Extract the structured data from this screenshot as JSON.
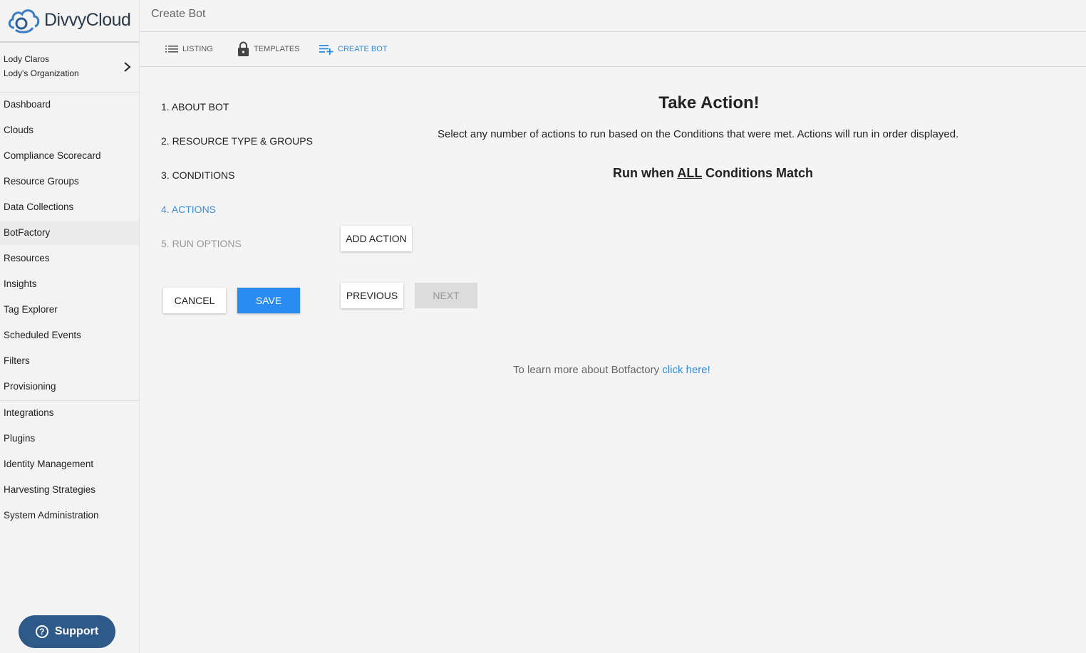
{
  "brand": {
    "name": "DivvyCloud"
  },
  "user": {
    "name": "Lody Claros",
    "organization": "Lody's Organization"
  },
  "sidebar": {
    "items": [
      {
        "label": "Dashboard"
      },
      {
        "label": "Clouds"
      },
      {
        "label": "Compliance Scorecard"
      },
      {
        "label": "Resource Groups"
      },
      {
        "label": "Data Collections"
      },
      {
        "label": "BotFactory"
      },
      {
        "label": "Resources"
      },
      {
        "label": "Insights"
      },
      {
        "label": "Tag Explorer"
      },
      {
        "label": "Scheduled Events"
      },
      {
        "label": "Filters"
      },
      {
        "label": "Provisioning"
      },
      {
        "label": "Integrations"
      },
      {
        "label": "Plugins"
      },
      {
        "label": "Identity Management"
      },
      {
        "label": "Harvesting Strategies"
      },
      {
        "label": "System Administration"
      }
    ],
    "active": "BotFactory",
    "support_label": "Support"
  },
  "header": {
    "title": "Create Bot"
  },
  "tabs": [
    {
      "label": "LISTING",
      "icon": "list-icon"
    },
    {
      "label": "TEMPLATES",
      "icon": "lock-icon"
    },
    {
      "label": "CREATE BOT",
      "icon": "playlist-add-icon",
      "active": true
    }
  ],
  "steps": [
    {
      "label": "1. ABOUT BOT"
    },
    {
      "label": "2. RESOURCE TYPE & GROUPS"
    },
    {
      "label": "3. CONDITIONS"
    },
    {
      "label": "4. ACTIONS",
      "state": "active"
    },
    {
      "label": "5. RUN OPTIONS",
      "state": "disabled"
    }
  ],
  "form_buttons": {
    "cancel": "CANCEL",
    "save": "SAVE"
  },
  "main": {
    "heading": "Take Action!",
    "description": "Select any number of actions to run based on the Conditions that were met. Actions will run in order displayed.",
    "subheading_prefix": "Run when ",
    "subheading_emphasis": "ALL",
    "subheading_suffix": " Conditions Match",
    "add_action": "ADD ACTION",
    "previous": "PREVIOUS",
    "next": "NEXT",
    "learn_more_text": "To learn more about Botfactory ",
    "learn_more_link": "click here!"
  },
  "colors": {
    "accent": "#2a8bf2",
    "support_bg": "#2e5a8a",
    "step_active": "#3a8fdc"
  }
}
